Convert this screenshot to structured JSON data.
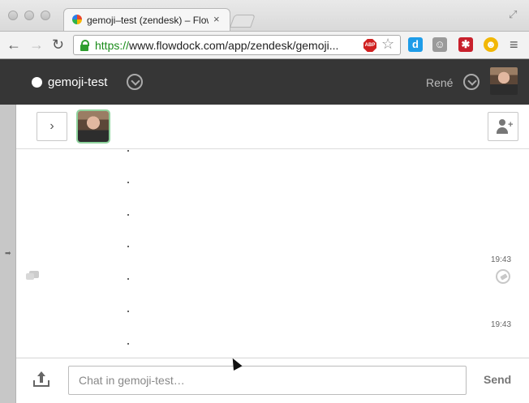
{
  "browser": {
    "tab_title": "gemoji–test (zendesk) – Flowdock",
    "tab_close": "×",
    "nav": {
      "back": "←",
      "forward": "→",
      "reload": "↻"
    },
    "url_scheme": "https://",
    "url_rest": "www.flowdock.com/app/zendesk/gemoji...",
    "star": "☆",
    "extensions": [
      {
        "name": "dash-icon",
        "glyph": "d",
        "color": "#1e9ce8"
      },
      {
        "name": "ghost-icon",
        "glyph": "☺",
        "color": "#9a9a9a"
      },
      {
        "name": "lastpass-icon",
        "glyph": "✱",
        "color": "#c8202c"
      },
      {
        "name": "smiley-icon",
        "glyph": "☻",
        "color": "#f2b705"
      }
    ],
    "menu": "≡"
  },
  "header": {
    "flow_name": "gemoji-test",
    "user_name": "René"
  },
  "usersbar": {
    "toggle": "›"
  },
  "chat": {
    "messages": [
      {
        "text": "."
      },
      {
        "text": "."
      },
      {
        "text": "."
      },
      {
        "text": "."
      },
      {
        "text": "."
      },
      {
        "text": "."
      },
      {
        "text": "."
      }
    ],
    "timestamps": [
      "19:43",
      "19:43"
    ]
  },
  "input": {
    "placeholder": "Chat in gemoji-test…",
    "send_label": "Send"
  }
}
